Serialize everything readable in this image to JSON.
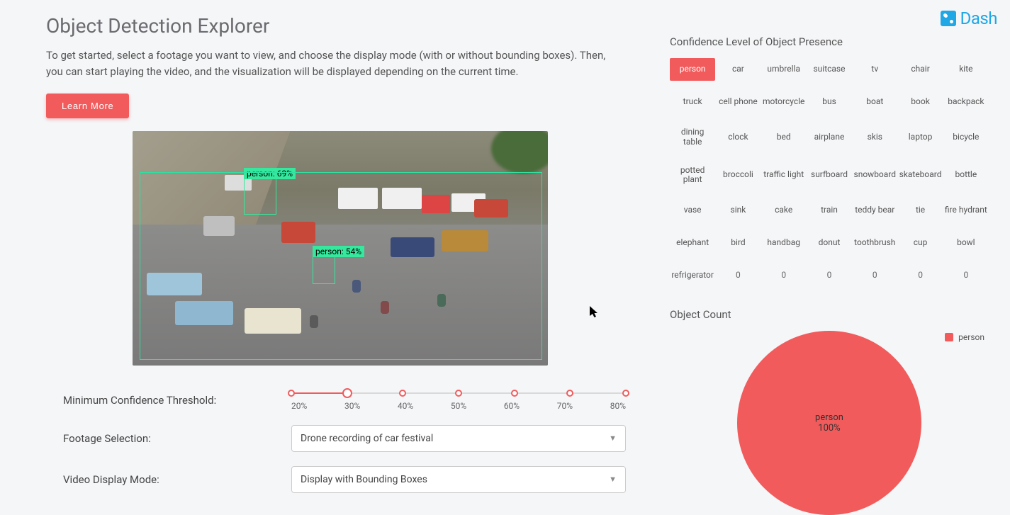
{
  "brand": {
    "name": "Dash"
  },
  "header": {
    "title": "Object Detection Explorer",
    "intro": "To get started, select a footage you want to view, and choose the display mode (with or without bounding boxes). Then, you can start playing the video, and the visualization will be displayed depending on the current time.",
    "learn_more": "Learn More"
  },
  "detections": {
    "box1_label": "person: 69%",
    "box2_label": "person: 54%"
  },
  "controls": {
    "threshold_label": "Minimum Confidence Threshold:",
    "footage_label": "Footage Selection:",
    "mode_label": "Video Display Mode:",
    "footage_value": "Drone recording of car festival",
    "mode_value": "Display with Bounding Boxes",
    "slider_ticks": [
      "20%",
      "30%",
      "40%",
      "50%",
      "60%",
      "70%",
      "80%"
    ],
    "slider_value_index": 1
  },
  "heatmap": {
    "title": "Confidence Level of Object Presence",
    "selected": "person",
    "rows": [
      [
        "person",
        "car",
        "umbrella",
        "suitcase",
        "tv",
        "chair",
        "kite"
      ],
      [
        "truck",
        "cell phone",
        "motorcycle",
        "bus",
        "boat",
        "book",
        "backpack"
      ],
      [
        "dining table",
        "clock",
        "bed",
        "airplane",
        "skis",
        "laptop",
        "bicycle"
      ],
      [
        "potted plant",
        "broccoli",
        "traffic light",
        "surfboard",
        "snowboard",
        "skateboard",
        "bottle"
      ],
      [
        "vase",
        "sink",
        "cake",
        "train",
        "teddy bear",
        "tie",
        "fire hydrant"
      ],
      [
        "elephant",
        "bird",
        "handbag",
        "donut",
        "toothbrush",
        "cup",
        "bowl"
      ],
      [
        "refrigerator",
        "0",
        "0",
        "0",
        "0",
        "0",
        "0"
      ]
    ]
  },
  "chart_data": {
    "type": "pie",
    "title": "Object Count",
    "series": [
      {
        "name": "person",
        "value": 100
      }
    ],
    "center_label_name": "person",
    "center_label_value": "100%",
    "legend": [
      "person"
    ]
  },
  "colors": {
    "accent": "#f15b5c",
    "brand": "#1fa7e6"
  }
}
